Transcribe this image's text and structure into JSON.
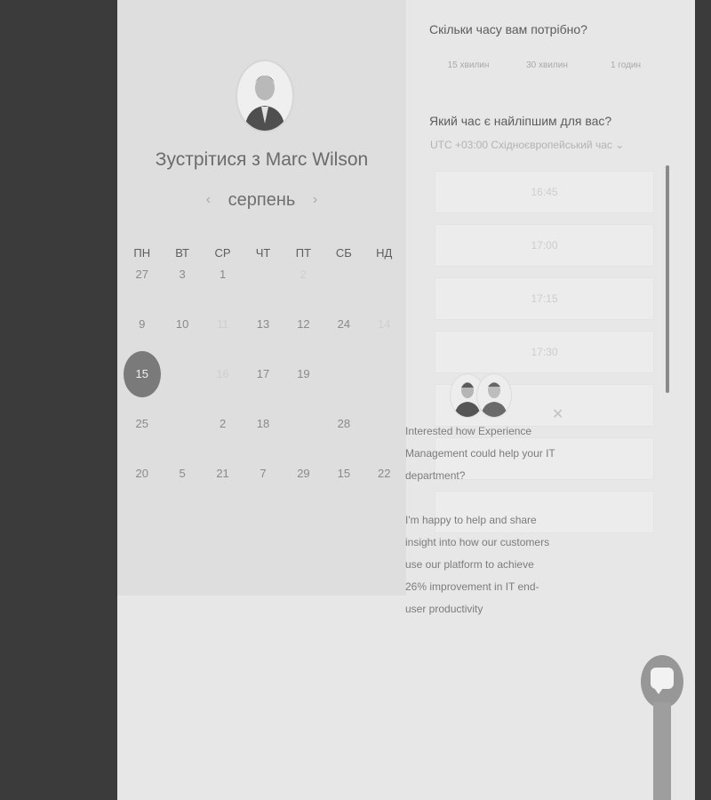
{
  "left": {
    "title": "Зустрітися з Marc Wilson",
    "month": "серпень",
    "prev_icon": "‹",
    "next_icon": "›",
    "weekdays": [
      "ПН",
      "ВТ",
      "СР",
      "ЧТ",
      "ПТ",
      "СБ",
      "НД"
    ],
    "weeks": [
      [
        "27",
        "3",
        "1",
        "",
        "2",
        "",
        ""
      ],
      [
        "9",
        "10",
        "11",
        "13",
        "12",
        "24",
        "14"
      ],
      [
        "15",
        "",
        "16",
        "17",
        "19",
        "",
        ""
      ],
      [
        "25",
        "",
        "2",
        "18",
        "",
        "28",
        ""
      ],
      [
        "20",
        "5",
        "21",
        "7",
        "29",
        "15",
        "22"
      ]
    ],
    "selected_day": "15"
  },
  "right": {
    "duration_question": "Скільки часу вам потрібно?",
    "durations": [
      "15 хвилин",
      "30 хвилин",
      "1 годин"
    ],
    "time_question": "Який час є найліпшим для вас?",
    "timezone": "UTC +03:00 Східноєвропейський час ⌄",
    "slots": [
      "16:45",
      "17:00",
      "17:15",
      "17:30"
    ]
  },
  "chat": {
    "close_icon": "✕",
    "message_1": "Interested how Experience Management could help your IT department?",
    "message_2": "I'm happy to help and share insight into how our customers use our platform to achieve 26% improvement in IT end-user productivity"
  }
}
